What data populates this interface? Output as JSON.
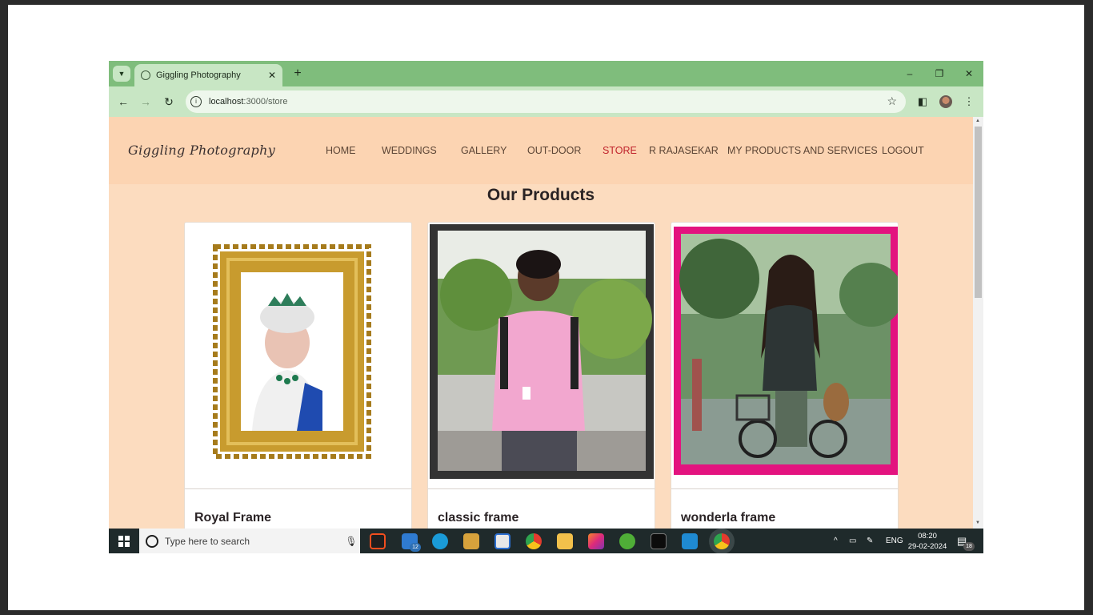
{
  "browser": {
    "tab_title": "Giggling Photography",
    "url_host": "localhost",
    "url_path": ":3000/store",
    "new_tab_glyph": "+",
    "minimize_glyph": "–",
    "restore_glyph": "❐",
    "close_glyph": "✕"
  },
  "site": {
    "logo": "Giggling Photography",
    "nav": [
      {
        "label": "HOME"
      },
      {
        "label": "WEDDINGS"
      },
      {
        "label": "GALLERY"
      },
      {
        "label": "OUT-DOOR"
      },
      {
        "label": "STORE",
        "active": true
      },
      {
        "label": "R RAJASEKAR"
      },
      {
        "label": "MY PRODUCTS AND SERVICES"
      },
      {
        "label": "LOGOUT"
      }
    ],
    "heading": "Our Products",
    "products": [
      {
        "name": "Royal Frame",
        "frame_color": "#c89b2e"
      },
      {
        "name": "classic frame",
        "frame_color": "#333333"
      },
      {
        "name": "wonderla frame",
        "frame_color": "#e3137f"
      }
    ]
  },
  "taskbar": {
    "search_placeholder": "Type here to search",
    "mail_badge": "12",
    "language": "ENG",
    "time": "08:20",
    "date": "29-02-2024",
    "notification_count": "18"
  },
  "colors": {
    "chrome_green": "#7fbd7c",
    "chrome_light": "#c8e6c4",
    "page_bg": "#fcdcbf",
    "nav_active": "#c0232c"
  }
}
